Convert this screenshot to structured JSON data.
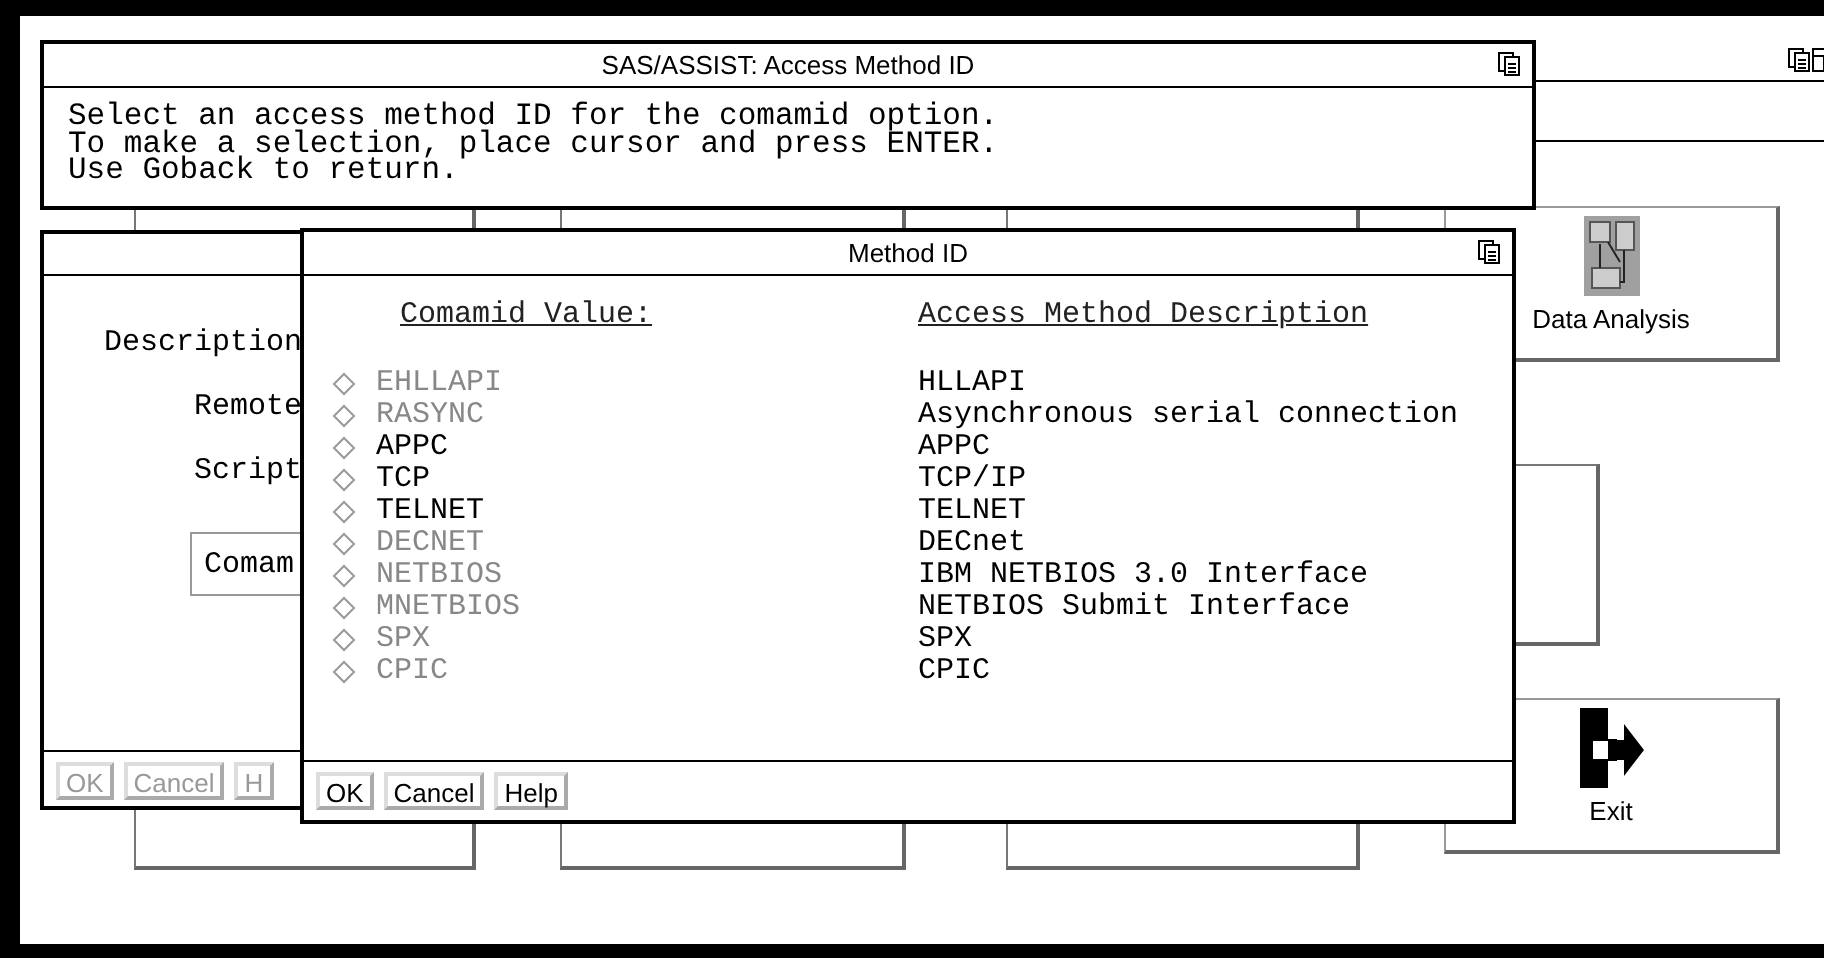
{
  "info_window": {
    "title": "SAS/ASSIST: Access Method ID",
    "lines": [
      "Select an access method ID for the comamid option.",
      "To make a selection, place cursor and press ENTER.",
      "Use Goback to return."
    ]
  },
  "background_window": {
    "buttons": [
      {
        "label": "Data Analysis",
        "kind": "analysis"
      },
      {
        "label": "Exit",
        "kind": "exit"
      }
    ]
  },
  "left_window": {
    "labels": [
      "Description",
      "Remote",
      "Script"
    ],
    "field_button": "Comam",
    "buttons": [
      {
        "label": "OK",
        "disabled": true
      },
      {
        "label": "Cancel",
        "disabled": true
      },
      {
        "label": "H",
        "disabled": true
      }
    ]
  },
  "dialog": {
    "title": "Method ID",
    "columns": [
      "Comamid Value:",
      "Access Method Description"
    ],
    "rows": [
      {
        "value": "EHLLAPI",
        "description": "HLLAPI",
        "disabled": true,
        "selected": false
      },
      {
        "value": "RASYNC",
        "description": "Asynchronous serial connection",
        "disabled": true,
        "selected": false
      },
      {
        "value": "APPC",
        "description": "APPC",
        "disabled": false,
        "selected": false
      },
      {
        "value": "TCP",
        "description": "TCP/IP",
        "disabled": false,
        "selected": false
      },
      {
        "value": "TELNET",
        "description": "TELNET",
        "disabled": false,
        "selected": false
      },
      {
        "value": "DECNET",
        "description": "DECnet",
        "disabled": true,
        "selected": false
      },
      {
        "value": "NETBIOS",
        "description": "IBM NETBIOS 3.0 Interface",
        "disabled": true,
        "selected": false
      },
      {
        "value": "MNETBIOS",
        "description": "NETBIOS Submit Interface",
        "disabled": true,
        "selected": false
      },
      {
        "value": "SPX",
        "description": "SPX",
        "disabled": true,
        "selected": false
      },
      {
        "value": "CPIC",
        "description": "CPIC",
        "disabled": true,
        "selected": false
      }
    ],
    "buttons": [
      {
        "label": "OK",
        "disabled": false
      },
      {
        "label": "Cancel",
        "disabled": false
      },
      {
        "label": "Help",
        "disabled": false
      }
    ]
  }
}
